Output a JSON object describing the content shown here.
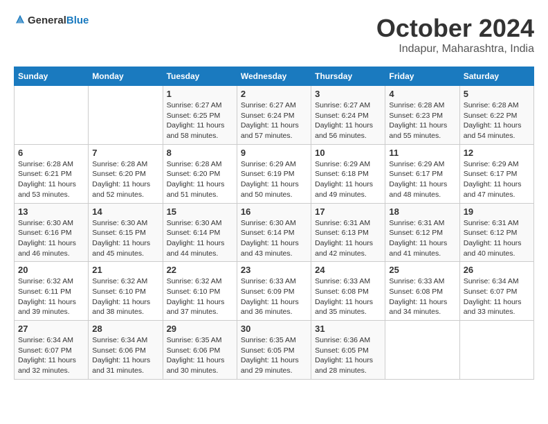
{
  "header": {
    "logo_general": "General",
    "logo_blue": "Blue",
    "title": "October 2024",
    "subtitle": "Indapur, Maharashtra, India"
  },
  "calendar": {
    "days_of_week": [
      "Sunday",
      "Monday",
      "Tuesday",
      "Wednesday",
      "Thursday",
      "Friday",
      "Saturday"
    ],
    "weeks": [
      [
        {
          "day": "",
          "info": ""
        },
        {
          "day": "",
          "info": ""
        },
        {
          "day": "1",
          "info": "Sunrise: 6:27 AM\nSunset: 6:25 PM\nDaylight: 11 hours and 58 minutes."
        },
        {
          "day": "2",
          "info": "Sunrise: 6:27 AM\nSunset: 6:24 PM\nDaylight: 11 hours and 57 minutes."
        },
        {
          "day": "3",
          "info": "Sunrise: 6:27 AM\nSunset: 6:24 PM\nDaylight: 11 hours and 56 minutes."
        },
        {
          "day": "4",
          "info": "Sunrise: 6:28 AM\nSunset: 6:23 PM\nDaylight: 11 hours and 55 minutes."
        },
        {
          "day": "5",
          "info": "Sunrise: 6:28 AM\nSunset: 6:22 PM\nDaylight: 11 hours and 54 minutes."
        }
      ],
      [
        {
          "day": "6",
          "info": "Sunrise: 6:28 AM\nSunset: 6:21 PM\nDaylight: 11 hours and 53 minutes."
        },
        {
          "day": "7",
          "info": "Sunrise: 6:28 AM\nSunset: 6:20 PM\nDaylight: 11 hours and 52 minutes."
        },
        {
          "day": "8",
          "info": "Sunrise: 6:28 AM\nSunset: 6:20 PM\nDaylight: 11 hours and 51 minutes."
        },
        {
          "day": "9",
          "info": "Sunrise: 6:29 AM\nSunset: 6:19 PM\nDaylight: 11 hours and 50 minutes."
        },
        {
          "day": "10",
          "info": "Sunrise: 6:29 AM\nSunset: 6:18 PM\nDaylight: 11 hours and 49 minutes."
        },
        {
          "day": "11",
          "info": "Sunrise: 6:29 AM\nSunset: 6:17 PM\nDaylight: 11 hours and 48 minutes."
        },
        {
          "day": "12",
          "info": "Sunrise: 6:29 AM\nSunset: 6:17 PM\nDaylight: 11 hours and 47 minutes."
        }
      ],
      [
        {
          "day": "13",
          "info": "Sunrise: 6:30 AM\nSunset: 6:16 PM\nDaylight: 11 hours and 46 minutes."
        },
        {
          "day": "14",
          "info": "Sunrise: 6:30 AM\nSunset: 6:15 PM\nDaylight: 11 hours and 45 minutes."
        },
        {
          "day": "15",
          "info": "Sunrise: 6:30 AM\nSunset: 6:14 PM\nDaylight: 11 hours and 44 minutes."
        },
        {
          "day": "16",
          "info": "Sunrise: 6:30 AM\nSunset: 6:14 PM\nDaylight: 11 hours and 43 minutes."
        },
        {
          "day": "17",
          "info": "Sunrise: 6:31 AM\nSunset: 6:13 PM\nDaylight: 11 hours and 42 minutes."
        },
        {
          "day": "18",
          "info": "Sunrise: 6:31 AM\nSunset: 6:12 PM\nDaylight: 11 hours and 41 minutes."
        },
        {
          "day": "19",
          "info": "Sunrise: 6:31 AM\nSunset: 6:12 PM\nDaylight: 11 hours and 40 minutes."
        }
      ],
      [
        {
          "day": "20",
          "info": "Sunrise: 6:32 AM\nSunset: 6:11 PM\nDaylight: 11 hours and 39 minutes."
        },
        {
          "day": "21",
          "info": "Sunrise: 6:32 AM\nSunset: 6:10 PM\nDaylight: 11 hours and 38 minutes."
        },
        {
          "day": "22",
          "info": "Sunrise: 6:32 AM\nSunset: 6:10 PM\nDaylight: 11 hours and 37 minutes."
        },
        {
          "day": "23",
          "info": "Sunrise: 6:33 AM\nSunset: 6:09 PM\nDaylight: 11 hours and 36 minutes."
        },
        {
          "day": "24",
          "info": "Sunrise: 6:33 AM\nSunset: 6:08 PM\nDaylight: 11 hours and 35 minutes."
        },
        {
          "day": "25",
          "info": "Sunrise: 6:33 AM\nSunset: 6:08 PM\nDaylight: 11 hours and 34 minutes."
        },
        {
          "day": "26",
          "info": "Sunrise: 6:34 AM\nSunset: 6:07 PM\nDaylight: 11 hours and 33 minutes."
        }
      ],
      [
        {
          "day": "27",
          "info": "Sunrise: 6:34 AM\nSunset: 6:07 PM\nDaylight: 11 hours and 32 minutes."
        },
        {
          "day": "28",
          "info": "Sunrise: 6:34 AM\nSunset: 6:06 PM\nDaylight: 11 hours and 31 minutes."
        },
        {
          "day": "29",
          "info": "Sunrise: 6:35 AM\nSunset: 6:06 PM\nDaylight: 11 hours and 30 minutes."
        },
        {
          "day": "30",
          "info": "Sunrise: 6:35 AM\nSunset: 6:05 PM\nDaylight: 11 hours and 29 minutes."
        },
        {
          "day": "31",
          "info": "Sunrise: 6:36 AM\nSunset: 6:05 PM\nDaylight: 11 hours and 28 minutes."
        },
        {
          "day": "",
          "info": ""
        },
        {
          "day": "",
          "info": ""
        }
      ]
    ]
  }
}
